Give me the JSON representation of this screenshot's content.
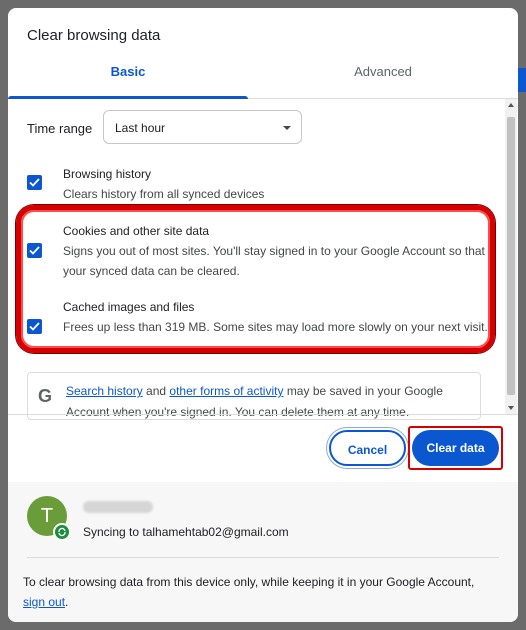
{
  "dialog": {
    "title": "Clear browsing data",
    "tabs": [
      {
        "label": "Basic",
        "active": true
      },
      {
        "label": "Advanced",
        "active": false
      }
    ],
    "time_range": {
      "label": "Time range",
      "value": "Last hour"
    },
    "options": [
      {
        "title": "Browsing history",
        "desc": "Clears history from all synced devices",
        "checked": true
      },
      {
        "title": "Cookies and other site data",
        "desc": "Signs you out of most sites. You'll stay signed in to your Google Account so that your synced data can be cleared.",
        "checked": true
      },
      {
        "title": "Cached images and files",
        "desc": "Frees up less than 319 MB. Some sites may load more slowly on your next visit.",
        "checked": true
      }
    ],
    "google_note": {
      "link1": "Search history",
      "and": "and",
      "link2": "other forms of activity",
      "rest": "may be saved in your Google Account when you're signed in. You can delete them at any time."
    },
    "buttons": {
      "cancel": "Cancel",
      "clear": "Clear data"
    },
    "account": {
      "avatar_letter": "T",
      "sync_text": "Syncing to talhamehtab02@gmail.com"
    },
    "bottom": {
      "text": "To clear browsing data from this device only, while keeping it in your Google Account,",
      "link": "sign out",
      "end": "."
    }
  },
  "colors": {
    "accent": "#0b57d0",
    "annotation": "#d70000",
    "avatar": "#6a9c3a"
  },
  "icons": [
    "check-icon",
    "chevron-down-icon",
    "google-g-icon",
    "sync-icon"
  ]
}
